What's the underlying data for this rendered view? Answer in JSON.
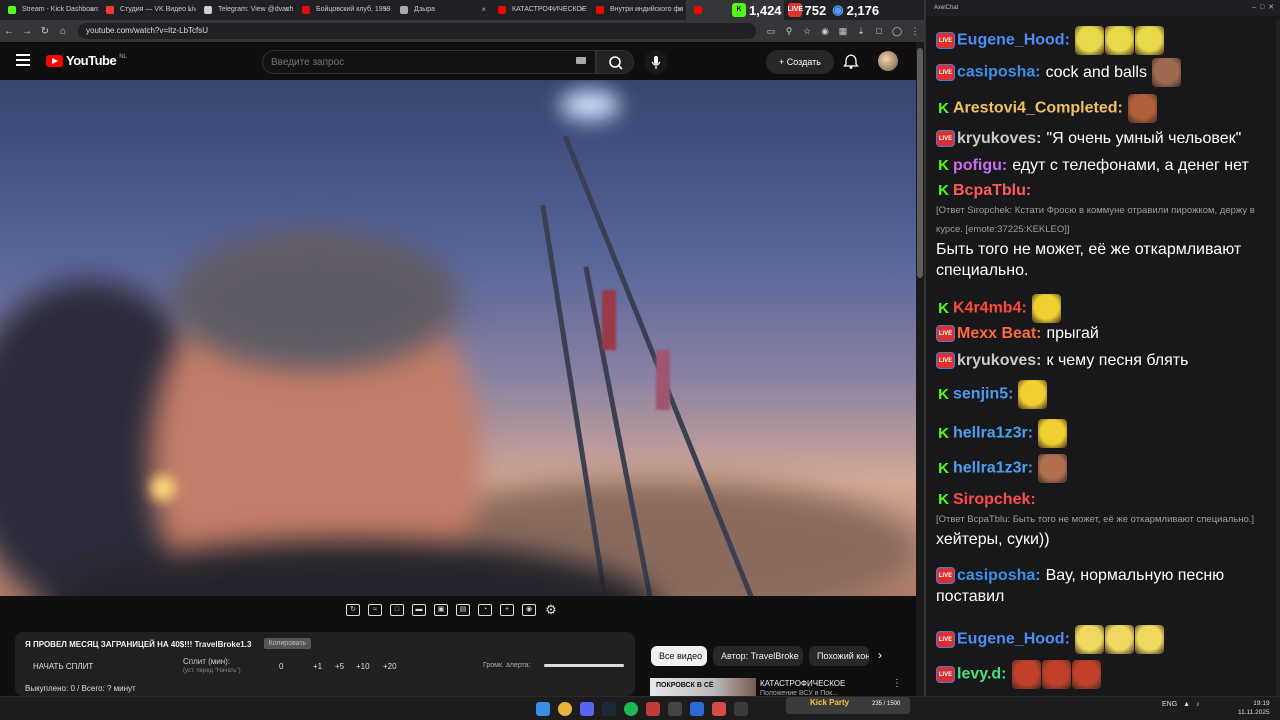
{
  "browser": {
    "tabs": [
      {
        "label": "Stream - Kick Dashboard",
        "color": "#53fc18"
      },
      {
        "label": "Студия — VK Видео Live",
        "color": "#ff3b30"
      },
      {
        "label": "Telegram: View @dvach",
        "color": "#cccccc"
      },
      {
        "label": "Бойцовский клуб, 1999",
        "color": "#e50914"
      },
      {
        "label": "Дзыра",
        "color": "#aaaaaa"
      },
      {
        "label": "КАТАСТРОФИЧЕСКОЕ",
        "color": "#ff0000"
      },
      {
        "label": "Внутри индийского фи",
        "color": "#ff0000"
      },
      {
        "label": "",
        "color": "#ff0000"
      }
    ],
    "stats": {
      "kick_viewers": "1,424",
      "vk_viewers": "752",
      "total_viewers": "2,176",
      "vk_label": "LIVE"
    },
    "url": "youtube.com/watch?v=Itz-LbTcfsU"
  },
  "youtube": {
    "logo": "YouTube",
    "region": "NL",
    "search_placeholder": "Введите запрос",
    "create_label": "Создать"
  },
  "split": {
    "title": "Я ПРОВЕЛ МЕСЯЦ ЗАГРАНИЦЕЙ НА 40$!!! TravelBroke1.3",
    "copy_label": "Копировать",
    "start_label": "НАЧАТЬ СПЛИТ",
    "split_label": "Сплит (мин):",
    "split_hint": "(уст. перед \"Начать\")",
    "split_value": "0",
    "increments": [
      "+1",
      "+5",
      "+10",
      "+20"
    ],
    "alert_label": "Громк. алерта:",
    "alert_level": 1.0,
    "spent": "Выкуплено: 0 / Всего: ? минут"
  },
  "chips": [
    "Все видео",
    "Автор: TravelBroke",
    "Похожий кон"
  ],
  "recommended": {
    "thumb_text": "ПОКРОВСК В СЁ",
    "title": "КАТАСТРОФИЧЕСКОЕ",
    "subtitle": "Положение ВСУ в Пок..."
  },
  "chat": {
    "window_title": "AxelChat",
    "messages": [
      {
        "badge": "live",
        "user": "Eugene_Hood:",
        "color": "#4c8cf5",
        "text": "",
        "emotes": 3,
        "emote_color": "#e8d94a"
      },
      {
        "badge": "live",
        "user": "casiposha:",
        "color": "#3c90e8",
        "text": "cock and balls",
        "emotes": 1,
        "emote_color": "#a06a50"
      },
      {
        "badge": "kick",
        "user": "Arestovi4_Completed:",
        "color": "#f0c060",
        "text": "",
        "emotes": 1,
        "emote_color": "#b0603a"
      },
      {
        "badge": "live",
        "user": "kryukoves:",
        "color": "#c9c9c9",
        "text": "\"Я очень умный чельовек\"",
        "emotes": 0
      },
      {
        "badge": "kick",
        "user": "pofigu:",
        "color": "#c86bf0",
        "text": "едут с телефонами, а денег нет",
        "emotes": 0
      },
      {
        "badge": "kick",
        "user": "BcpaTblu:",
        "color": "#ff5a5a",
        "text": "",
        "emotes": 0,
        "reply": "[Ответ Siropchek: Кстати Фросю в коммуне отравили пирожком, держу в курсе. [emote:37225:KEKLEO]]",
        "body": "Быть того не может, её же откармливают специально."
      },
      {
        "badge": "kick",
        "user": "K4r4mb4:",
        "color": "#ff4a3a",
        "text": "",
        "emotes": 1,
        "emote_color": "#f0d030"
      },
      {
        "badge": "live",
        "user": "Mexx Beat:",
        "color": "#ff6a3a",
        "text": "прыгай",
        "emotes": 0
      },
      {
        "badge": "live",
        "user": "kryukoves:",
        "color": "#c9c9c9",
        "text": "к чему песня блять",
        "emotes": 0
      },
      {
        "badge": "kick",
        "user": "senjin5:",
        "color": "#4a9af0",
        "text": "",
        "emotes": 1,
        "emote_color": "#f0d030"
      },
      {
        "badge": "kick",
        "user": "hellra1z3r:",
        "color": "#4aa0f0",
        "text": "",
        "emotes": 1,
        "emote_color": "#f0d030"
      },
      {
        "badge": "kick",
        "user": "hellra1z3r:",
        "color": "#4aa0f0",
        "text": "",
        "emotes": 1,
        "emote_color": "#b07050"
      },
      {
        "badge": "kick",
        "user": "Siropchek:",
        "color": "#ff4a4a",
        "text": "",
        "emotes": 0,
        "reply": "[Ответ BcpaTblu: Быть того не может, её же откармливают специально.]",
        "body": "хейтеры, суки))"
      },
      {
        "badge": "live",
        "user": "casiposha:",
        "color": "#3c90e8",
        "text": "Вау, нормальную песню поставил",
        "emotes": 0
      },
      {
        "badge": "live",
        "user": "Eugene_Hood:",
        "color": "#4c8cf5",
        "text": "",
        "emotes": 3,
        "emote_color": "#f0d860"
      },
      {
        "badge": "live",
        "user": "levy.d:",
        "color": "#4ce07a",
        "text": "",
        "emotes": 3,
        "emote_color": "#c0402a"
      }
    ]
  },
  "taskbar": {
    "kick_label": "Kick Party",
    "kick_count": "235 / 1500",
    "lang": "ENG",
    "time": "19:19",
    "date": "11.11.2025"
  }
}
